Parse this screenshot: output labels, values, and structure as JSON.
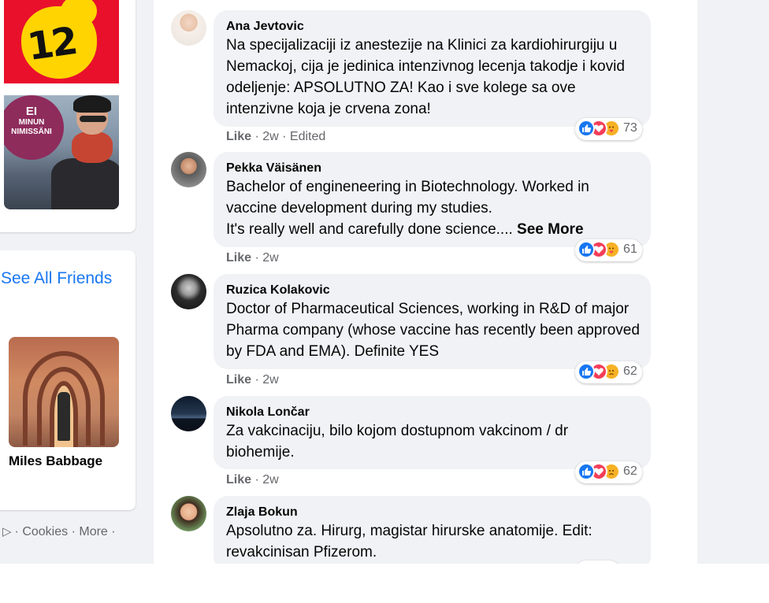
{
  "sidebar": {
    "photo_tiles": [
      {
        "badge_number": "12"
      },
      {
        "badge_line1": "EI",
        "badge_line2": "MINUN",
        "badge_line3": "NIMISSÄNI"
      }
    ],
    "see_all_friends": "See All Friends",
    "friend": {
      "name": "Miles Babbage"
    },
    "footer": {
      "cookies": "· Cookies ·",
      "more": "More ·"
    }
  },
  "comments": [
    {
      "author": "Ana Jevtovic",
      "text": "Na specijalizaciji iz anestezije na Klinici za kardiohirurgiju u Nemackoj, cija je jedinica intenzivnog lecenja takodje i kovid odeljenje: APSOLUTNO ZA! Kao i sve kolege sa ove intenzivne koja je crvena zona!",
      "like": "Like",
      "time": "· 2w · Edited",
      "reactions": [
        "like",
        "love",
        "care"
      ],
      "reaction_count": "73"
    },
    {
      "author": "Pekka Väisänen",
      "text_line1": "Bachelor of engineneering in Biotechnology. Worked in vaccine development during my studies.",
      "text_line2": "It's really well and carefully done science.... ",
      "see_more": "See More",
      "like": "Like",
      "time": "· 2w",
      "reactions": [
        "like",
        "love",
        "care"
      ],
      "reaction_count": "61"
    },
    {
      "author": "Ruzica Kolakovic",
      "text": "Doctor of Pharmaceutical Sciences, working in R&D of major Pharma company (whose vaccine has recently been approved by FDA and EMA). Definite YES",
      "like": "Like",
      "time": "· 2w",
      "reactions": [
        "like",
        "love",
        "sad"
      ],
      "reaction_count": "62"
    },
    {
      "author": "Nikola Lončar",
      "text": "Za vakcinaciju, bilo kojom dostupnom vakcinom / dr biohemije.",
      "like": "Like",
      "time": "· 2w",
      "reactions": [
        "like",
        "love",
        "sad"
      ],
      "reaction_count": "62"
    },
    {
      "author": "Zlaja Bokun",
      "text": "Apsolutno za. Hirurg, magistar hirurske anatomije. Edit: revakcinisan Pfizerom."
    }
  ],
  "colors": {
    "link": "#1877f2",
    "page_bg": "#f0f2f5",
    "bubble_bg": "#f0f2f5",
    "meta_text": "#65676b"
  }
}
